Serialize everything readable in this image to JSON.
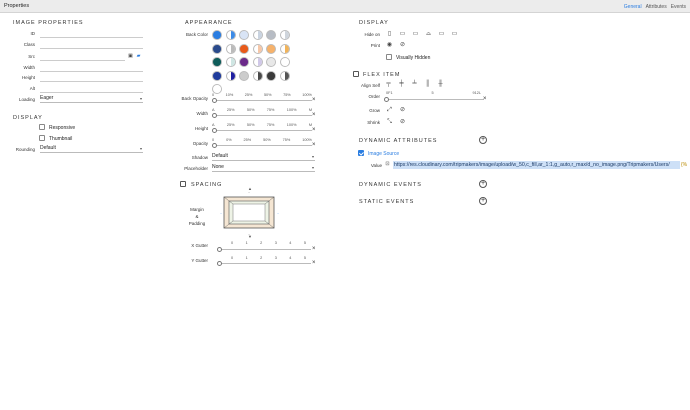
{
  "window": {
    "title": "Properties"
  },
  "tabs": {
    "general": "General",
    "attributes": "Attributes",
    "events": "Events"
  },
  "image_properties": {
    "header": "IMAGE PROPERTIES",
    "id_label": "ID",
    "class_label": "Class",
    "src_label": "Src",
    "width_label": "Width",
    "height_label": "Height",
    "alt_label": "Alt",
    "loading_label": "Loading",
    "loading_value": "Eager"
  },
  "display_left": {
    "header": "DISPLAY",
    "responsive": "Responsive",
    "thumbnail": "Thumbnail",
    "rounding_label": "Rounding",
    "rounding_value": "Default"
  },
  "appearance": {
    "header": "APPEARANCE",
    "back_color_label": "Back Color",
    "back_opacity": {
      "label": "Back Opacity",
      "ticks": [
        "0",
        "10%",
        "25%",
        "50%",
        "75%",
        "100%"
      ]
    },
    "width": {
      "label": "Width",
      "ticks": [
        "A",
        "25%",
        "50%",
        "75%",
        "100%",
        "M"
      ]
    },
    "height": {
      "label": "Height",
      "ticks": [
        "A",
        "25%",
        "50%",
        "75%",
        "100%",
        "M"
      ]
    },
    "opacity": {
      "label": "Opacity",
      "ticks": [
        "0",
        "0%",
        "25%",
        "50%",
        "75%",
        "100%"
      ]
    },
    "shadow_label": "Shadow",
    "shadow_value": "Default",
    "placeholder_label": "Placeholder",
    "placeholder_value": "None",
    "swatch_colors": [
      "#2a7de1",
      "#3d8be6",
      "#d9e4f5",
      "#c9d3e0",
      "#b7bcc4",
      "#cfd5dc",
      "#2a4a8c",
      "#bbbbbb",
      "#e85a1a",
      "#f6c7a8",
      "#f6b26b",
      "#f0b35a",
      "#0e5c5a",
      "#cfe6e3",
      "#6b2a8a",
      "#d0c8e8",
      "#e8e8e8",
      "#ffffff",
      "#1f3b9c",
      "#1f1fa0",
      "#cccccc",
      "#4a4a4a",
      "#3a3a3a",
      "#555555",
      "#ffffff"
    ]
  },
  "spacing": {
    "header": "SPACING",
    "margin_padding_label": "Margin\n&\nPadding",
    "x_gutter": {
      "label": "X Gutter",
      "ticks": [
        "0",
        "1",
        "2",
        "3",
        "4",
        "5"
      ]
    },
    "y_gutter": {
      "label": "Y Gutter",
      "ticks": [
        "0",
        "1",
        "2",
        "3",
        "4",
        "5"
      ]
    }
  },
  "display_right": {
    "header": "DISPLAY",
    "hide_on_label": "Hide on",
    "print_label": "Print",
    "visually_hidden": "Visually Hidden"
  },
  "flex_item": {
    "header": "FLEX ITEM",
    "align_self_label": "Align Self",
    "order": {
      "label": "Order",
      "ticks": [
        "0",
        "F",
        "1",
        "5",
        "9",
        "12",
        "L"
      ]
    },
    "grow_label": "Grow",
    "shrink_label": "Shrink"
  },
  "dynamic_attributes": {
    "header": "DYNAMIC ATTRIBUTES",
    "image_source": "Image Source",
    "value_label": "Value",
    "value": "https://res.cloudinary.com/tripmakers/image/upload/w_50,c_fill,ar_1:1,g_auto,r_max/d_no_image.png/Tripmakers/Users/",
    "value_suffix": "{%"
  },
  "dynamic_events": {
    "header": "DYNAMIC EVENTS"
  },
  "static_events": {
    "header": "STATIC EVENTS"
  }
}
